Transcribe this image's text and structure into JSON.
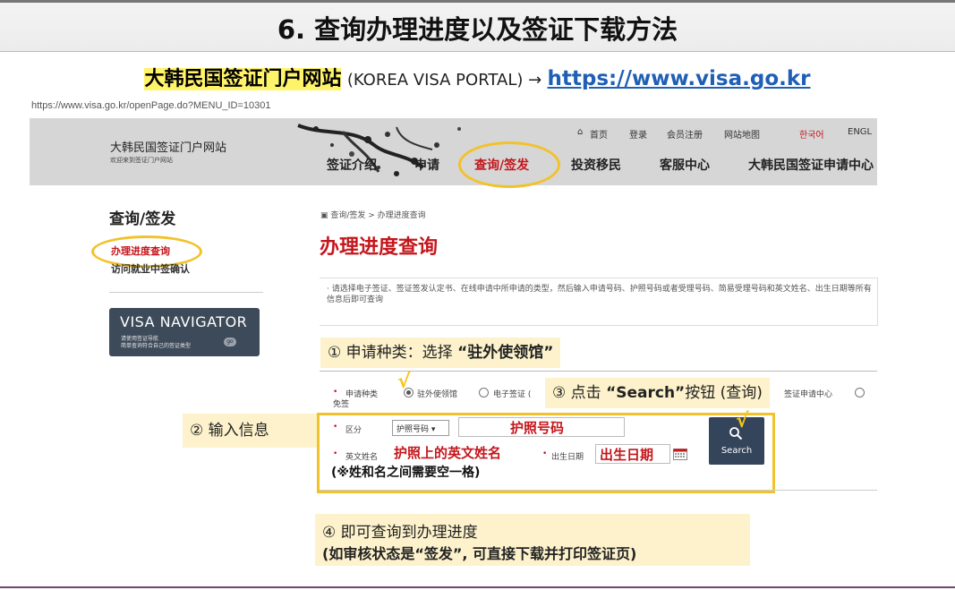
{
  "slide": {
    "title": "6. 查询办理进度以及签证下载方法",
    "portal_cn": "大韩民国签证门户网站",
    "portal_en": "(KOREA VISA PORTAL) →",
    "portal_url": "https://www.visa.go.kr"
  },
  "browser": {
    "url": "https://www.visa.go.kr/openPage.do?MENU_ID=10301"
  },
  "site_header": {
    "logo_cn": "大韩民国签证门户网站",
    "logo_sub": "欢迎来到签证门户网站",
    "top_links": [
      "首页",
      "登录",
      "会员注册",
      "网站地图",
      "한국어",
      "ENGL"
    ],
    "main_nav": [
      "签证介绍",
      "申请",
      "查询/签发",
      "投资移民",
      "客服中心",
      "大韩民国签证申请中心"
    ]
  },
  "sidebar": {
    "title": "查询/签发",
    "items": [
      "办理进度查询",
      "访问就业中签确认"
    ],
    "visa_navigator": {
      "title": "VISA NAVIGATOR",
      "sub1": "请使用签证导航",
      "sub2": "简单查询符合自己的签证类型",
      "go": "go"
    }
  },
  "main": {
    "breadcrumb": "查询/签发 > 办理进度查询",
    "heading": "办理进度查询",
    "notice": "· 请选择电子签证、签证签发认定书、在线申请中所申请的类型，然后输入申请号码、护照号码或者受理号码、简易受理号码和英文姓名、出生日期等所有信息后即可查询",
    "form": {
      "apptype_label_1": "申请种类",
      "apptype_label_2": "免签",
      "radio_1": "驻外使领馆",
      "radio_2": "电子签证 (",
      "radio_3": "签证申请中心",
      "category_label": "区分",
      "category_value": "护照号码 ▾",
      "passport_placeholder": "护照号码",
      "engname_label": "英文姓名",
      "engname_placeholder": "护照上的英文姓名",
      "dob_label": "出生日期",
      "dob_placeholder": "出生日期",
      "name_note": "(※姓和名之间需要空一格)",
      "search_label": "Search"
    }
  },
  "callouts": {
    "c1_prefix": "① 申请种类：选择 ",
    "c1_bold": "“驻外使领馆”",
    "c2": "② 输入信息",
    "c3_prefix": "③ 点击 ",
    "c3_bold": "“Search”",
    "c3_suffix": "按钮 (查询)",
    "c4_line1": "④ 即可查询到办理进度",
    "c4_line2": "(如审核状态是“签发”, 可直接下载并打印签证页)"
  },
  "colors": {
    "accent_red": "#c4161c",
    "highlight_yellow": "#f2c22b",
    "callout_bg": "#fdf2cc",
    "link_blue": "#1f5fb5"
  }
}
